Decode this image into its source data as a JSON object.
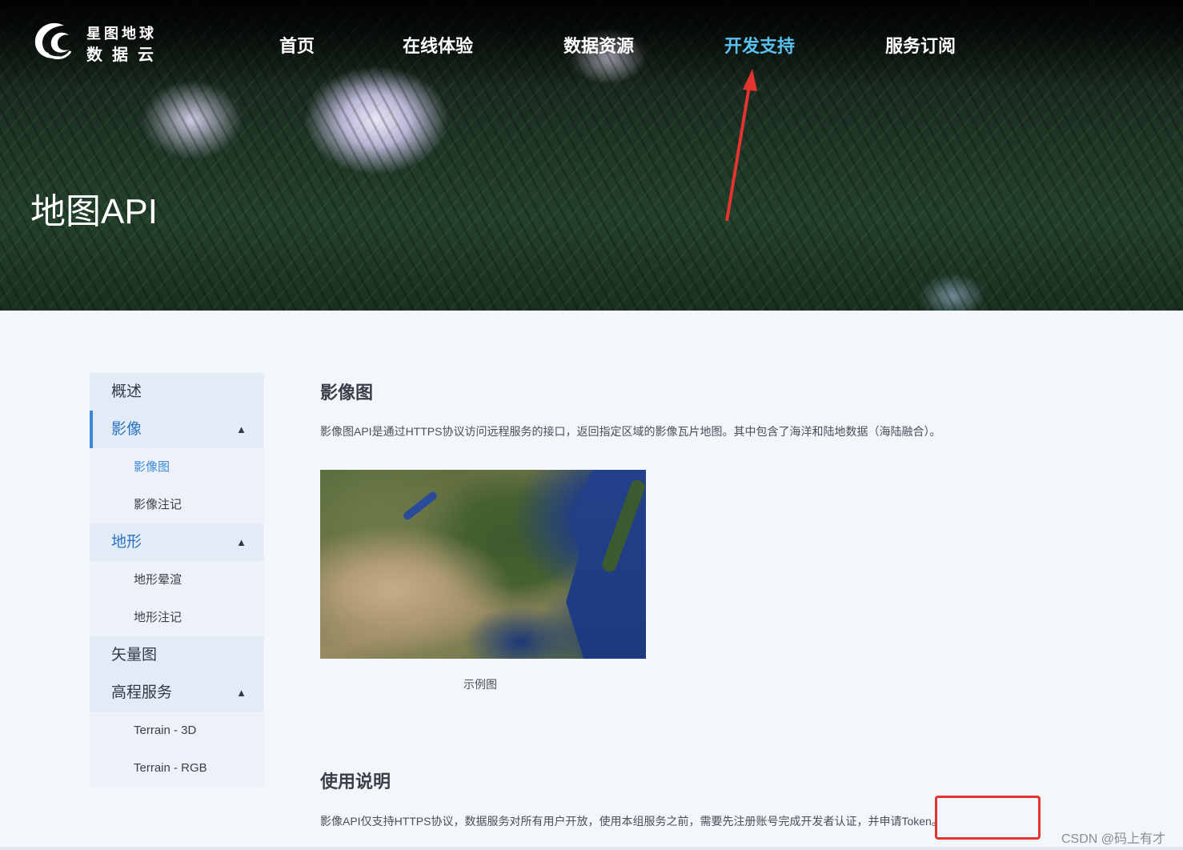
{
  "logo": {
    "line1": "星图地球",
    "line2": "数据云"
  },
  "nav": {
    "items": [
      {
        "label": "首页"
      },
      {
        "label": "在线体验"
      },
      {
        "label": "数据资源"
      },
      {
        "label": "开发支持",
        "active": true
      },
      {
        "label": "服务订阅"
      }
    ]
  },
  "hero": {
    "title": "地图API"
  },
  "sidebar": {
    "items": [
      {
        "label": "概述",
        "level": 1
      },
      {
        "label": "影像",
        "level": 1,
        "active": true,
        "chevron": "chevron-up-icon"
      },
      {
        "label": "影像图",
        "level": 2,
        "active": true
      },
      {
        "label": "影像注记",
        "level": 2
      },
      {
        "label": "地形",
        "level": 1,
        "chevron": "chevron-up-icon"
      },
      {
        "label": "地形晕渲",
        "level": 2
      },
      {
        "label": "地形注记",
        "level": 2
      },
      {
        "label": "矢量图",
        "level": 1
      },
      {
        "label": "高程服务",
        "level": 1,
        "chevron": "chevron-up-icon"
      },
      {
        "label": "Terrain - 3D",
        "level": 2
      },
      {
        "label": "Terrain - RGB",
        "level": 2
      }
    ]
  },
  "content": {
    "section1_title": "影像图",
    "section1_text": "影像图API是通过HTTPS协议访问远程服务的接口，返回指定区域的影像瓦片地图。其中包含了海洋和陆地数据（海陆融合）。",
    "image_caption": "示例图",
    "section2_title": "使用说明",
    "section2_text": "影像API仅支持HTTPS协议，数据服务对所有用户开放，使用本组服务之前，需要先注册账号完成开发者认证，并申请Token。"
  },
  "watermark": "CSDN @码上有才",
  "colors": {
    "nav_active": "#58c2f2",
    "sidebar_active": "#3b8ad8",
    "annotation_red": "#e3342f"
  }
}
